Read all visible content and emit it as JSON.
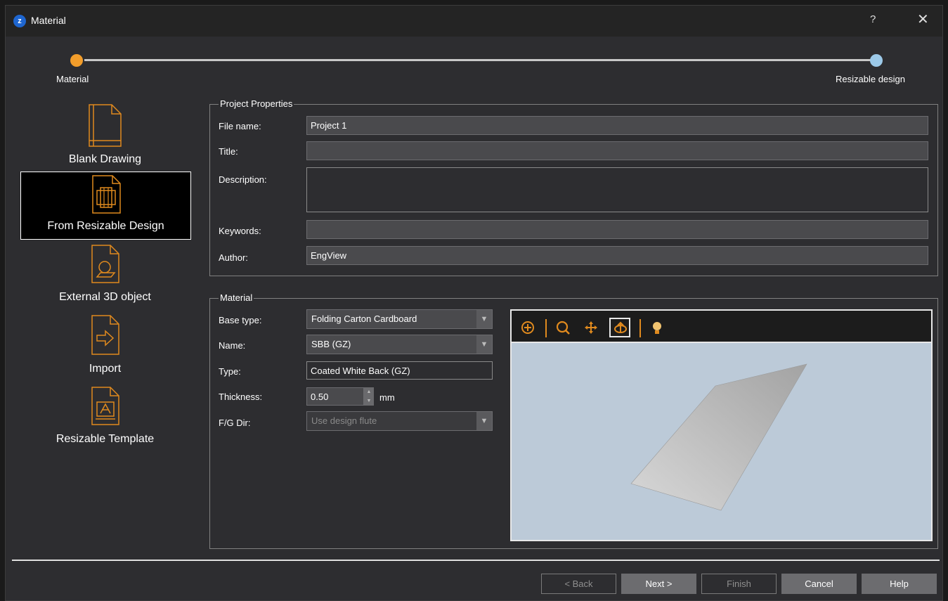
{
  "window": {
    "title": "Material",
    "help_label": "?",
    "close_label": "✕"
  },
  "wizard": {
    "step1": "Material",
    "step2": "Resizable design",
    "step1_color": "#f29d2b",
    "step2_color": "#9cc9e8"
  },
  "left_panel": {
    "items": [
      {
        "label": "Blank Drawing",
        "icon": "blank-drawing-icon"
      },
      {
        "label": "From Resizable Design",
        "icon": "resizable-design-icon",
        "selected": true
      },
      {
        "label": "External 3D object",
        "icon": "external-3d-icon"
      },
      {
        "label": "Import",
        "icon": "import-icon"
      },
      {
        "label": "Resizable Template",
        "icon": "resizable-template-icon"
      }
    ]
  },
  "project": {
    "title": "Project Properties",
    "file_name_label": "File name:",
    "file_name": "Project 1",
    "title_label": "Title:",
    "title_value": "",
    "description_label": "Description:",
    "description": "",
    "keywords_label": "Keywords:",
    "keywords": "",
    "author_label": "Author:",
    "author": "EngView"
  },
  "material": {
    "title": "Material",
    "base_type_label": "Base type:",
    "base_type": "Folding Carton Cardboard",
    "name_label": "Name:",
    "name": "SBB (GZ)",
    "type_label": "Type:",
    "type": "Coated White Back (GZ)",
    "thickness_label": "Thickness:",
    "thickness": "0.50",
    "thickness_unit": "mm",
    "fg_dir_label": "F/G Dir:",
    "fg_dir": "Use design flute"
  },
  "viewer": {
    "tools": [
      "zoom-window-icon",
      "zoom-icon",
      "pan-icon",
      "rotate-icon",
      "light-icon"
    ],
    "accent": "#e08a1e",
    "background": "#bccad8"
  },
  "buttons": {
    "back": "< Back",
    "back_key": "B",
    "next": "Next >",
    "next_key": "N",
    "finish": "Finish",
    "cancel": "Cancel",
    "help": "Help",
    "help_key": "H"
  }
}
